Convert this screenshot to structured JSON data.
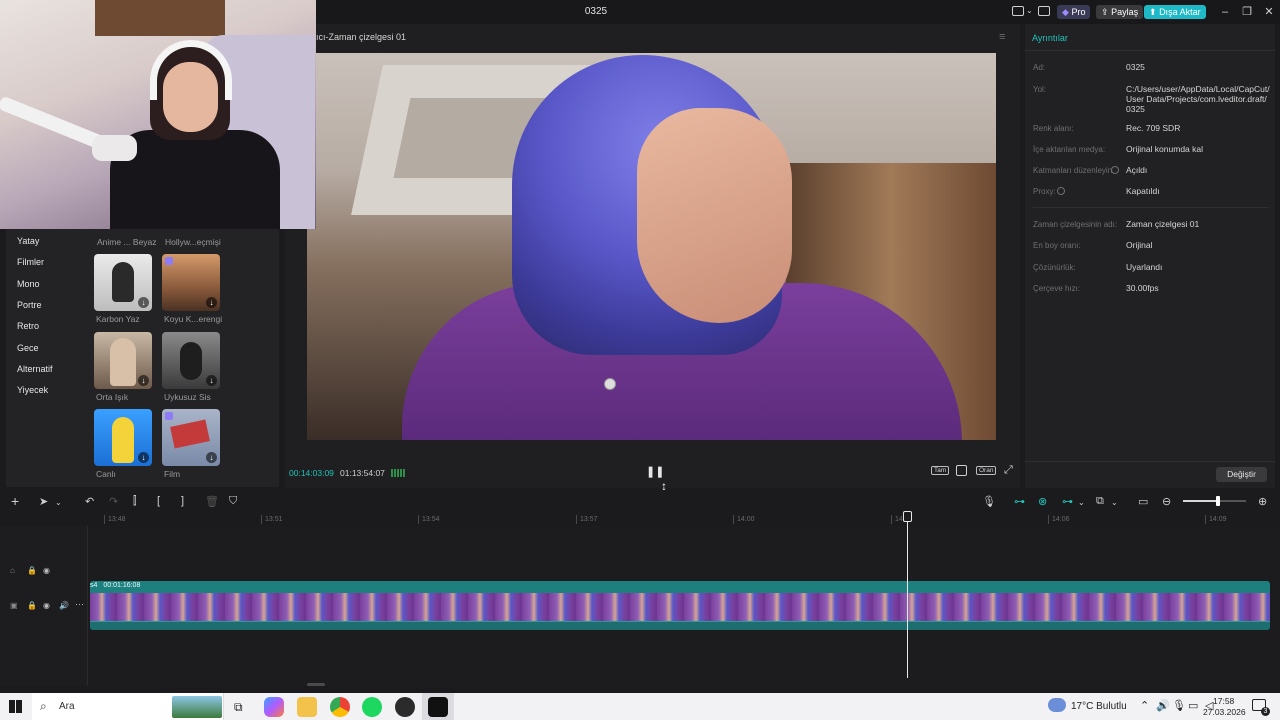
{
  "titlebar": {
    "title": "0325",
    "pro_label": "Pro",
    "share_label": "Paylaş",
    "export_label": "Dışa Aktar"
  },
  "left_panel": {
    "categories": [
      "Yatay",
      "Filmler",
      "Mono",
      "Portre",
      "Retro",
      "Gece",
      "Alternatif",
      "Yiyecek"
    ],
    "partial_labels": [
      "Anime ... Beyaz",
      "Hollyw...eçmişi"
    ],
    "filters": [
      {
        "name": "Karbon Yaz"
      },
      {
        "name": "Koyu K...erengi"
      },
      {
        "name": "Orta Işık"
      },
      {
        "name": "Uykusuz Sis"
      },
      {
        "name": "Canlı"
      },
      {
        "name": "Film"
      }
    ]
  },
  "player": {
    "title": "ıcı-Zaman çizelgesi 01",
    "current_time": "00:14:03:09",
    "total_time": "01:13:54:07",
    "full_label": "Tam",
    "ratio_label": "Oran"
  },
  "details": {
    "header": "Ayrıntılar",
    "rows": [
      {
        "label": "Ad:",
        "value": "0325"
      },
      {
        "label": "Yol:",
        "value": "C:/Users/user/AppData/Local/CapCut/User Data/Projects/com.lveditor.draft/0325"
      },
      {
        "label": "Renk alanı:",
        "value": "Rec. 709 SDR"
      },
      {
        "label": "İçe aktarılan medya:",
        "value": "Orijinal konumda kal"
      },
      {
        "label": "Katmanları düzenleyin",
        "value": "Açıldı"
      },
      {
        "label": "Proxy:",
        "value": "Kapatıldı"
      },
      {
        "label": "Zaman çizelgesinin adı:",
        "value": "Zaman çizelgesi 01"
      },
      {
        "label": "En boy oranı:",
        "value": "Orijinal"
      },
      {
        "label": "Çözünürlük:",
        "value": "Uyarlandı"
      },
      {
        "label": "Çerçeve hızı:",
        "value": "30.00fps"
      }
    ],
    "modify_button": "Değiştir"
  },
  "timeline": {
    "ticks": [
      "13:48",
      "13:51",
      "13:54",
      "13:57",
      "14:00",
      "14:0",
      "14:06",
      "14:09"
    ],
    "clip_duration": "00:01:16:08",
    "clip_prefix": "s4"
  },
  "taskbar": {
    "search_placeholder": "Ara",
    "weather": "17°C  Bulutlu",
    "time": "17:58",
    "date": "27.03.2026",
    "notification_count": "3"
  },
  "colors": {
    "accent": "#1fc3b8",
    "export": "#1fb8c6",
    "clip": "#1e7f7f"
  }
}
